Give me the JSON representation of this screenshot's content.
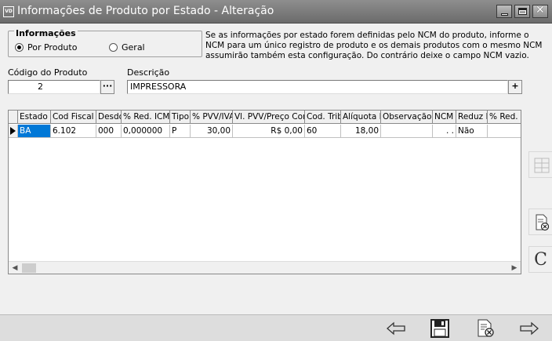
{
  "window": {
    "icon_label": "VD",
    "title": "Informações de Produto por Estado - Alteração"
  },
  "info_group": {
    "title": "Informações",
    "option_por_produto": "Por Produto",
    "option_geral": "Geral",
    "selected": "Por Produto"
  },
  "info_text": "Se as informações por estado forem definidas pelo NCM do produto, informe o NCM para um único registro de produto e os demais produtos com o mesmo NCM assumirão também esta configuração. Do contrário deixe o campo NCM vazio.",
  "fields": {
    "codigo_label": "Código do Produto",
    "codigo_value": "2",
    "codigo_button": "···",
    "descricao_label": "Descrição",
    "descricao_value": "IMPRESSORA",
    "descricao_button": "+"
  },
  "grid": {
    "columns": [
      "Estado",
      "Cod Fiscal",
      "Desdo",
      "% Red. ICM",
      "Tipo",
      "% PVV/IVA",
      "Vl. PVV/Preço Cons",
      "Cod. Trib",
      "Alíquota Ir",
      "Observação",
      "NCM",
      "Reduz B",
      "% Red."
    ],
    "rows": [
      [
        "BA",
        "6.102",
        "000",
        "0,000000",
        "P",
        "30,00",
        "R$ 0,00",
        "60",
        "18,00",
        "",
        ". .",
        "Não",
        ""
      ]
    ]
  },
  "scroll": {
    "left_arrow": "◀",
    "right_arrow": "▶"
  },
  "side_buttons": {
    "clear_label": "C"
  },
  "colors": {
    "titlebar": "#7a7a7a",
    "selection": "#0078d7",
    "background": "#f0f0f0"
  }
}
